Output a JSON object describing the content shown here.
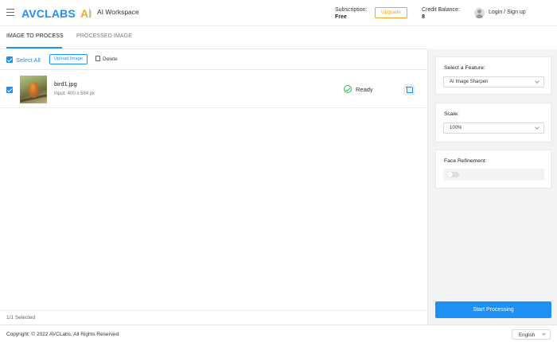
{
  "header": {
    "brand": "AVCLABS",
    "brand_ai": "AI",
    "workspace": "AI Workspace",
    "subscription_label": "Subscription:",
    "subscription_value": "Free",
    "upgrade_label": "Upgrade",
    "credit_label": "Credit Balance:",
    "credit_value": "8",
    "login_label": "Login / Sign up"
  },
  "tabs": [
    {
      "label": "IMAGE TO PROCESS",
      "active": true
    },
    {
      "label": "PROCESSED IMAGE",
      "active": false
    }
  ],
  "toolbar": {
    "select_all_label": "Select All",
    "upload_label": "Upload Image",
    "delete_label": "Delete"
  },
  "files": [
    {
      "name": "bird1.jpg",
      "info": "Input: 400 x 584 px",
      "status": "Ready",
      "checked": true
    }
  ],
  "selection": {
    "count_text": "1/1 Selected"
  },
  "panel": {
    "feature_title": "Select a Feature:",
    "feature_value": "AI Image Sharpen",
    "scale_title": "Scale:",
    "scale_value": "100%",
    "face_title": "Face Refinement:",
    "face_enabled": false,
    "start_label": "Start Processing"
  },
  "footer": {
    "copyright": "Copyright: © 2022 AVCLabs. All Rights Reserved",
    "language": "English"
  },
  "colors": {
    "accent": "#1e8ff4",
    "brand_ai": "#f5a623",
    "ready": "#34b35a"
  }
}
